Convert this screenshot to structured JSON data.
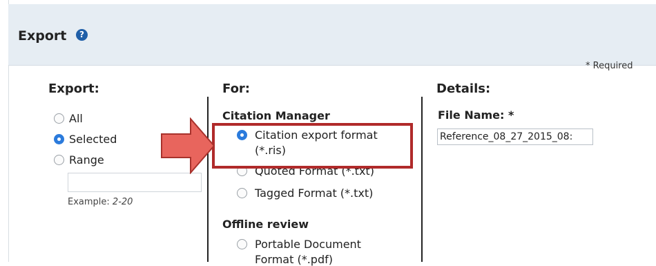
{
  "header": {
    "title": "Export",
    "help_icon": "help-question-icon"
  },
  "required_note": "* Required",
  "export_col": {
    "title": "Export:",
    "options": [
      {
        "label": "All",
        "selected": false
      },
      {
        "label": "Selected",
        "selected": true
      },
      {
        "label": "Range",
        "selected": false
      }
    ],
    "range_value": "",
    "example_prefix": "Example:",
    "example_value": "2-20"
  },
  "for_col": {
    "title": "For:",
    "group1": "Citation Manager",
    "group1_options": [
      {
        "line1": "Citation export format",
        "line2": "(*.ris)",
        "selected": true
      },
      {
        "line1": "Quoted Format (*.txt)",
        "selected": false
      },
      {
        "line1": "Tagged Format (*.txt)",
        "selected": false
      }
    ],
    "group2": "Offline review",
    "group2_options": [
      {
        "line1": "Portable Document",
        "line2": "Format (*.pdf)",
        "selected": false
      }
    ]
  },
  "details_col": {
    "title": "Details:",
    "file_name_label": "File Name: *",
    "file_name_value": "Reference_08_27_2015_08:"
  },
  "colors": {
    "accent": "#2b7bdc",
    "highlight": "#b02a2a",
    "arrow": "#e8655d",
    "header_bg": "#e6edf3"
  }
}
